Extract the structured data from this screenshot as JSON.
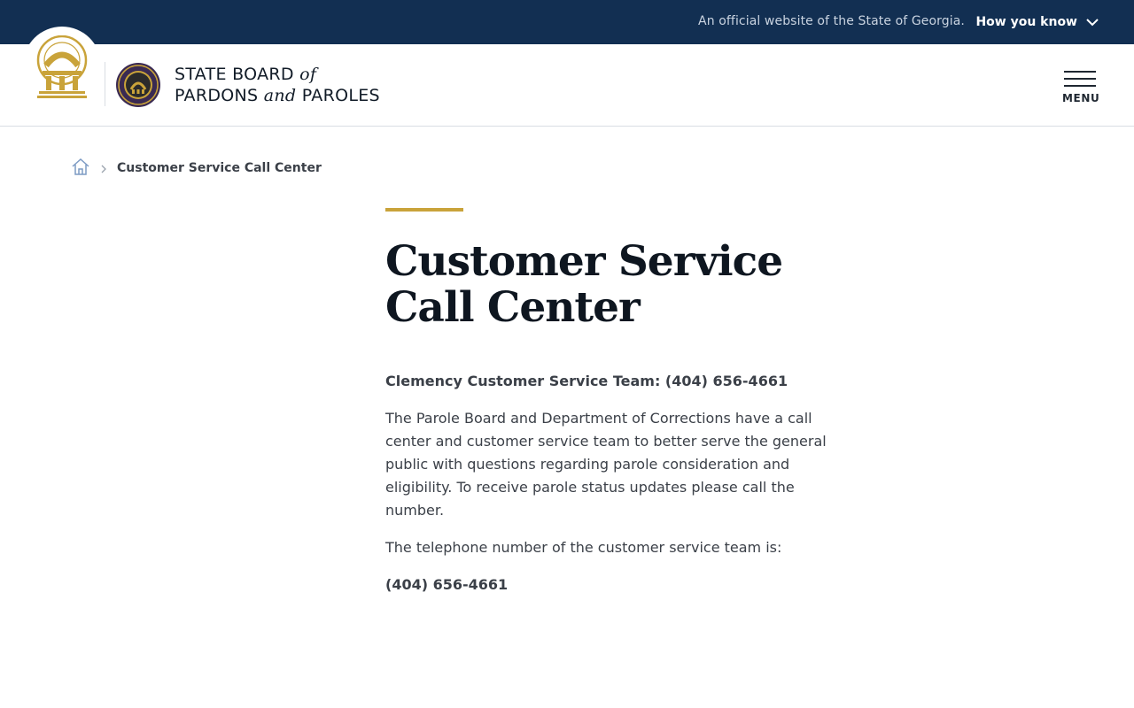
{
  "banner": {
    "official_text": "An official website of the State of Georgia.",
    "how_you_know": "How you know",
    "bg_color": "#122f52"
  },
  "header": {
    "board_name_line1": "STATE BOARD",
    "board_name_of": "of",
    "board_name_line2a": "PARDONS",
    "board_name_and": "and",
    "board_name_line2b": "PAROLES",
    "menu_label": "MENU",
    "logo_icon": "georgia-capitol-arch-icon",
    "seal_icon": "board-seal-icon"
  },
  "breadcrumb": {
    "home_icon": "home-icon",
    "current": "Customer Service Call Center"
  },
  "main": {
    "accent_color": "#c9a33a",
    "title": "Customer Service Call Center",
    "team_line": "Clemency Customer Service Team: (404) 656-4661",
    "description": "The Parole Board and Department of Corrections have a call center and customer service team to better serve the general public with questions regarding parole consideration and eligibility. To receive parole status updates please call the number.",
    "phone_intro": "The telephone number of the customer service team is:",
    "phone": "(404) 656-4661"
  }
}
